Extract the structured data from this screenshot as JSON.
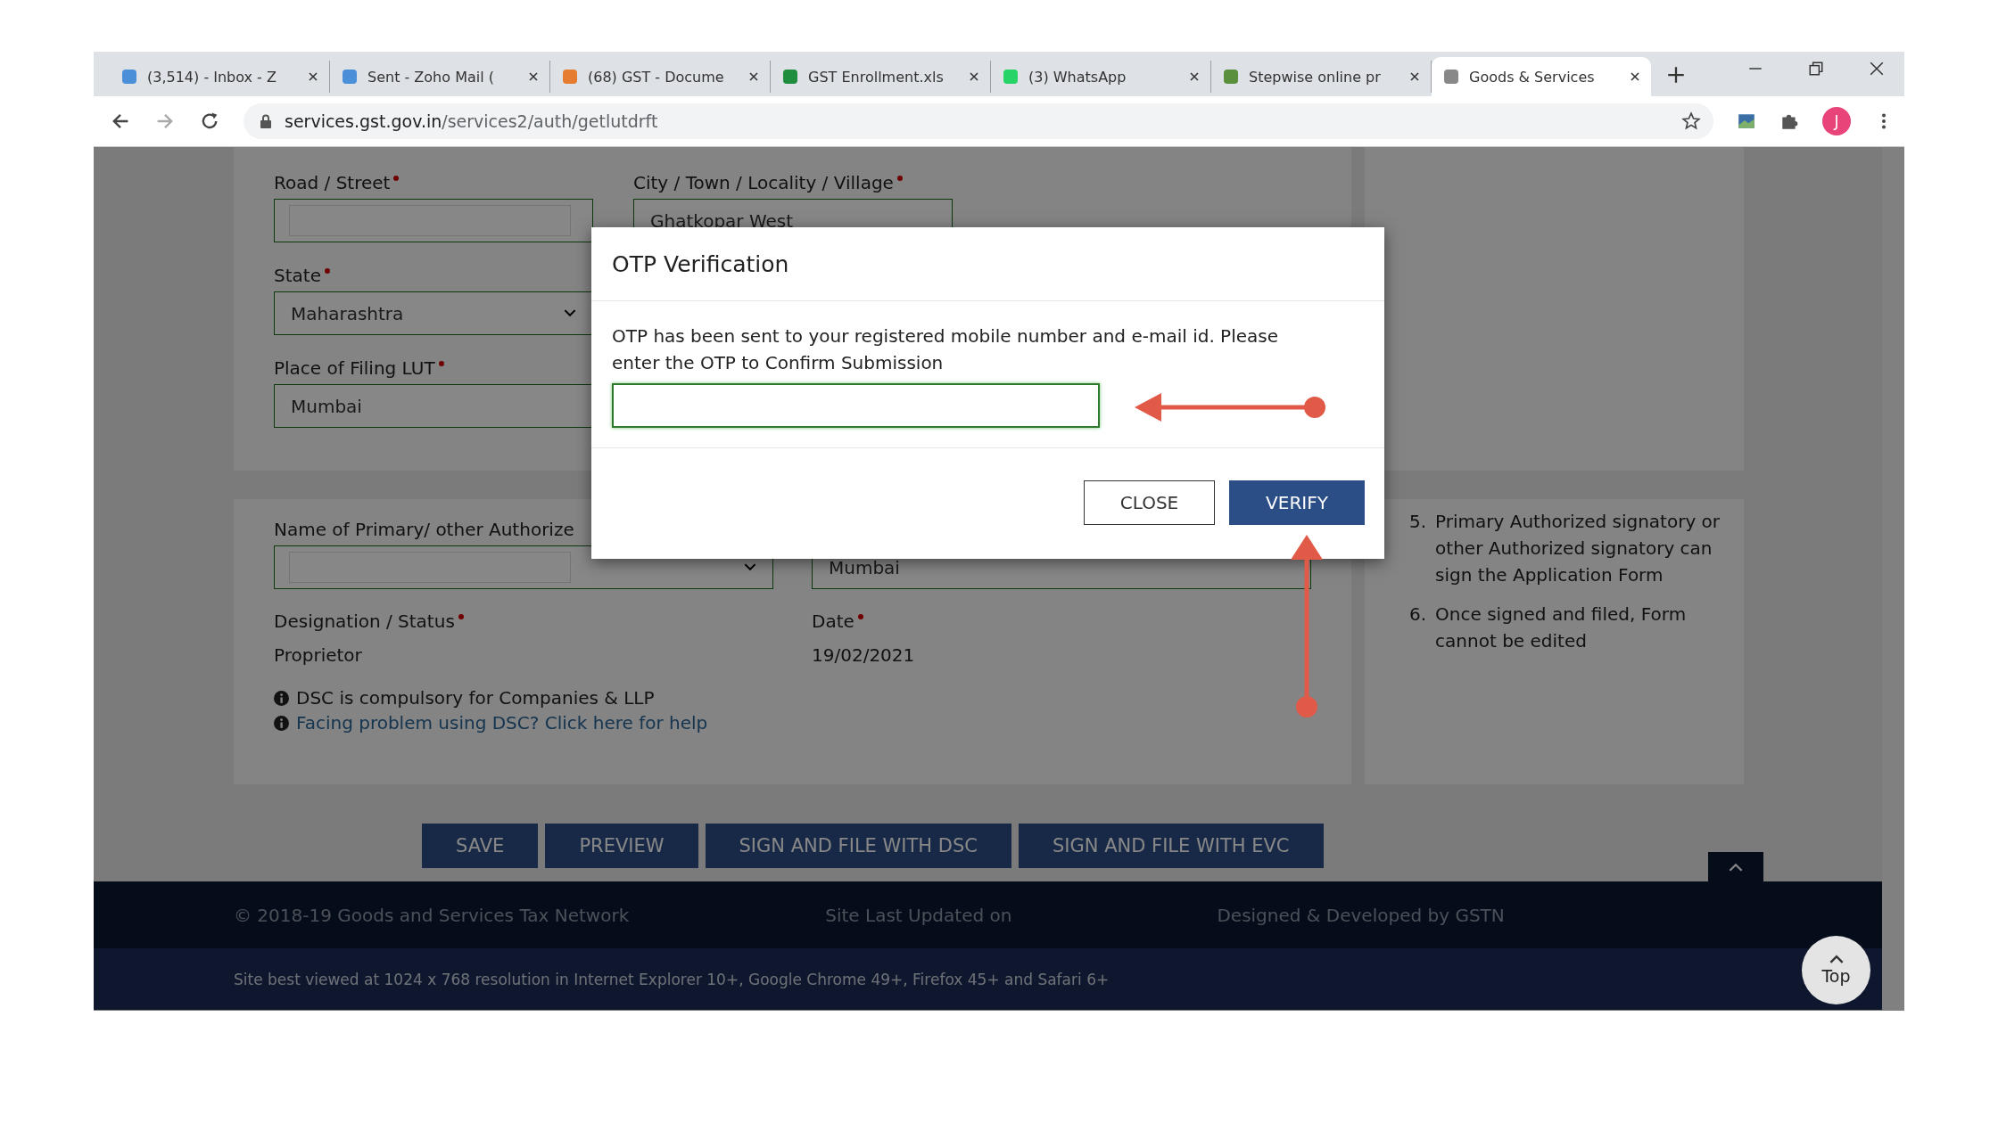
{
  "browser": {
    "tabs": [
      {
        "title": "(3,514) - Inbox - Z",
        "selected": false
      },
      {
        "title": "Sent - Zoho Mail (",
        "selected": false
      },
      {
        "title": "(68) GST - Docume",
        "selected": false
      },
      {
        "title": "GST Enrollment.xls",
        "selected": false
      },
      {
        "title": "(3) WhatsApp",
        "selected": false
      },
      {
        "title": "Stepwise online pr",
        "selected": false
      },
      {
        "title": "Goods & Services",
        "selected": true
      }
    ],
    "url_host": "services.gst.gov.in",
    "url_path": "/services2/auth/getlutdrft",
    "profile_initial": "J"
  },
  "address_panel": {
    "fields": [
      {
        "label": "Road / Street",
        "required": true,
        "kind": "redacted"
      },
      {
        "label": "City / Town / Locality / Village",
        "required": true,
        "kind": "text",
        "value": "Ghatkopar West"
      },
      {
        "label": "State",
        "required": true,
        "kind": "select",
        "value": "Maharashtra"
      },
      {
        "label": "Place of Filing LUT",
        "required": true,
        "kind": "text",
        "value": "Mumbai"
      }
    ]
  },
  "signatory_panel": {
    "name_label": "Name of Primary/ other Authorize",
    "place_value": "Mumbai",
    "designation_label": "Designation / Status",
    "designation_required": true,
    "designation": "Proprietor",
    "date_label": "Date",
    "date_required": true,
    "date": "19/02/2021",
    "note": "DSC is compulsory for Companies & LLP",
    "help_link": "Facing problem using DSC? Click here for help"
  },
  "instructions": [
    {
      "number": "5.",
      "text": "Primary Authorized signatory or other Authorized signatory can sign the Application Form"
    },
    {
      "number": "6.",
      "text": "Once signed and filed, Form cannot be edited"
    }
  ],
  "actions": [
    "SAVE",
    "PREVIEW",
    "SIGN AND FILE WITH DSC",
    "SIGN AND FILE WITH EVC"
  ],
  "footer": {
    "copyright": "© 2018-19 Goods and Services Tax Network",
    "updated": "Site Last Updated on",
    "developer": "Designed & Developed by GSTN",
    "best_viewed": "Site best viewed at 1024 x 768 resolution in Internet Explorer 10+, Google Chrome 49+, Firefox 45+ and Safari 6+",
    "top_button": "Top"
  },
  "modal": {
    "title": "OTP Verification",
    "message": "OTP has been sent to your registered mobile number and e-mail id. Please enter the OTP to Confirm Submission",
    "buttons": [
      {
        "label": "CLOSE",
        "kind": "secondary"
      },
      {
        "label": "VERIFY",
        "kind": "primary"
      }
    ]
  }
}
